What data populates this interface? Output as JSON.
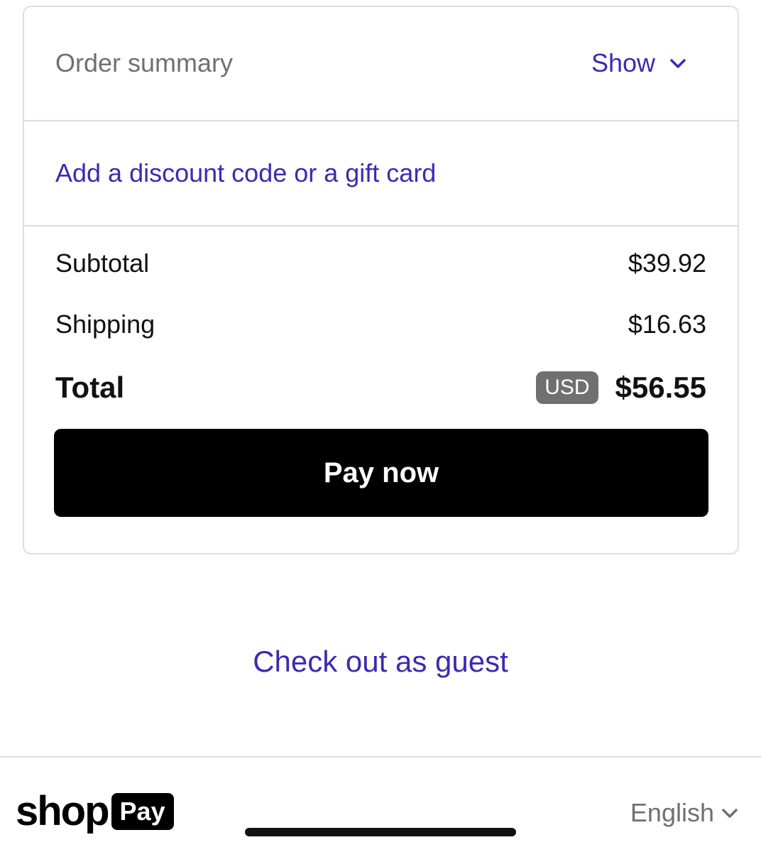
{
  "order_summary": {
    "label": "Order summary",
    "toggle_label": "Show",
    "toggle_icon": "chevron-down-icon"
  },
  "discount": {
    "link_label": "Add a discount code or a gift card"
  },
  "totals": {
    "subtotal_label": "Subtotal",
    "subtotal_value": "$39.92",
    "shipping_label": "Shipping",
    "shipping_value": "$16.63",
    "total_label": "Total",
    "currency": "USD",
    "total_value": "$56.55"
  },
  "pay_button": {
    "label": "Pay now"
  },
  "guest_link": {
    "label": "Check out as guest"
  },
  "footer": {
    "logo_word": "shop",
    "logo_badge": "Pay",
    "language": "English",
    "language_icon": "chevron-down-icon"
  },
  "colors": {
    "accent": "#3b2bb0",
    "button_bg": "#000000",
    "muted_text": "#707070",
    "border": "#dedede"
  }
}
